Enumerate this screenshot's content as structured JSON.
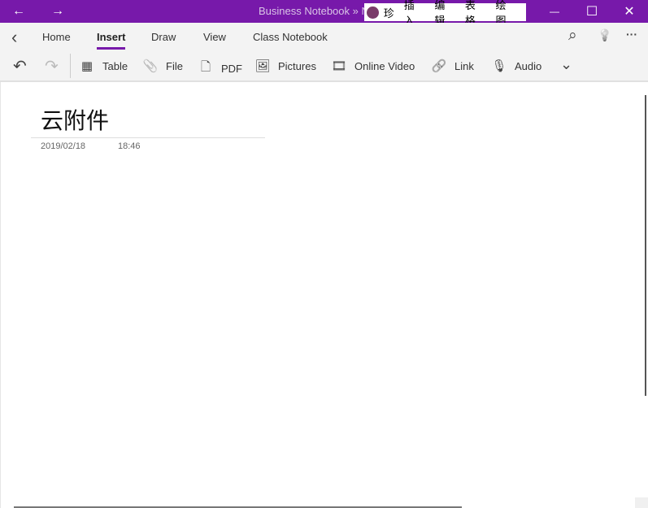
{
  "titlebar": {
    "title": "Business Notebook » N",
    "back_icon": "←",
    "forward_icon": "→",
    "minimize": "—",
    "maximize": "☐",
    "close": "✕"
  },
  "ime": {
    "items": [
      "珍",
      "插入",
      "编辑",
      "表格",
      "绘图"
    ]
  },
  "nav": {
    "back": "‹",
    "tabs": [
      "Home",
      "Insert",
      "Draw",
      "View",
      "Class Notebook"
    ],
    "active": "Insert",
    "search": "⌕",
    "idea": "💡",
    "more": "···"
  },
  "toolbar": {
    "undo": "↶",
    "redo": "↷",
    "items": [
      {
        "label": "Table",
        "icon": "▦"
      },
      {
        "label": "File",
        "icon": "📎"
      },
      {
        "label": "PDF",
        "icon": "🗋"
      },
      {
        "label": "Pictures",
        "icon": "🖼"
      },
      {
        "label": "Online Video",
        "icon": "🎞"
      },
      {
        "label": "Link",
        "icon": "🔗"
      },
      {
        "label": "Audio",
        "icon": "🎙"
      }
    ],
    "expand": "⌄"
  },
  "page": {
    "title": "云附件",
    "date": "2019/02/18",
    "time": "18:46"
  }
}
